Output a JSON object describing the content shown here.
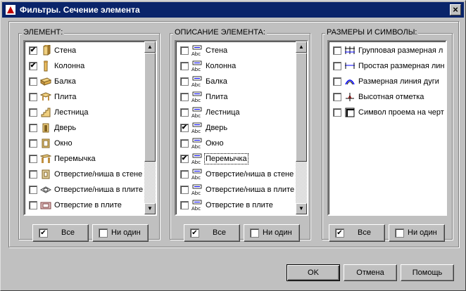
{
  "window": {
    "title": "Фильтры. Сечение элемента",
    "close_glyph": "×"
  },
  "element_group": {
    "title": "ЭЛЕМЕНТ:",
    "items": [
      {
        "label": "Стена",
        "checked": true,
        "icon": "wall-icon"
      },
      {
        "label": "Колонна",
        "checked": true,
        "icon": "column-icon"
      },
      {
        "label": "Балка",
        "checked": false,
        "icon": "beam-icon"
      },
      {
        "label": "Плита",
        "checked": false,
        "icon": "slab-icon"
      },
      {
        "label": "Лестница",
        "checked": false,
        "icon": "stair-icon"
      },
      {
        "label": "Дверь",
        "checked": false,
        "icon": "door-icon"
      },
      {
        "label": "Окно",
        "checked": false,
        "icon": "window-icon"
      },
      {
        "label": "Перемычка",
        "checked": false,
        "icon": "lintel-icon"
      },
      {
        "label": "Отверстие/ниша в стене",
        "checked": false,
        "icon": "wall-opening-icon"
      },
      {
        "label": "Отверстие/ниша в плите",
        "checked": false,
        "icon": "slab-niche-icon"
      },
      {
        "label": "Отверстие в плите",
        "checked": false,
        "icon": "slab-opening-icon"
      }
    ],
    "btn_all": "Все",
    "btn_none": "Ни один"
  },
  "desc_group": {
    "title": "ОПИСАНИЕ ЭЛЕМЕНТА:",
    "items": [
      {
        "label": "Стена",
        "checked": false
      },
      {
        "label": "Колонна",
        "checked": false
      },
      {
        "label": "Балка",
        "checked": false
      },
      {
        "label": "Плита",
        "checked": false
      },
      {
        "label": "Лестница",
        "checked": false
      },
      {
        "label": "Дверь",
        "checked": true
      },
      {
        "label": "Окно",
        "checked": false
      },
      {
        "label": "Перемычка",
        "checked": true
      },
      {
        "label": "Отверстие/ниша в стене",
        "checked": false
      },
      {
        "label": "Отверстие/ниша в плите",
        "checked": false
      },
      {
        "label": "Отверстие в плите",
        "checked": false
      }
    ],
    "icon_text": "Abc",
    "btn_all": "Все",
    "btn_none": "Ни один"
  },
  "dims_group": {
    "title": "РАЗМЕРЫ И СИМВОЛЫ:",
    "items": [
      {
        "label": "Групповая размерная л",
        "checked": false,
        "icon": "group-dimension-icon"
      },
      {
        "label": "Простая размерная лин",
        "checked": false,
        "icon": "simple-dimension-icon"
      },
      {
        "label": "Размерная линия дуги",
        "checked": false,
        "icon": "arc-dimension-icon"
      },
      {
        "label": "Высотная отметка",
        "checked": false,
        "icon": "elevation-mark-icon"
      },
      {
        "label": "Символ проема на черт",
        "checked": false,
        "icon": "opening-symbol-icon"
      }
    ],
    "btn_all": "Все",
    "btn_none": "Ни один"
  },
  "footer": {
    "ok": "OK",
    "cancel": "Отмена",
    "help": "Помощь"
  }
}
